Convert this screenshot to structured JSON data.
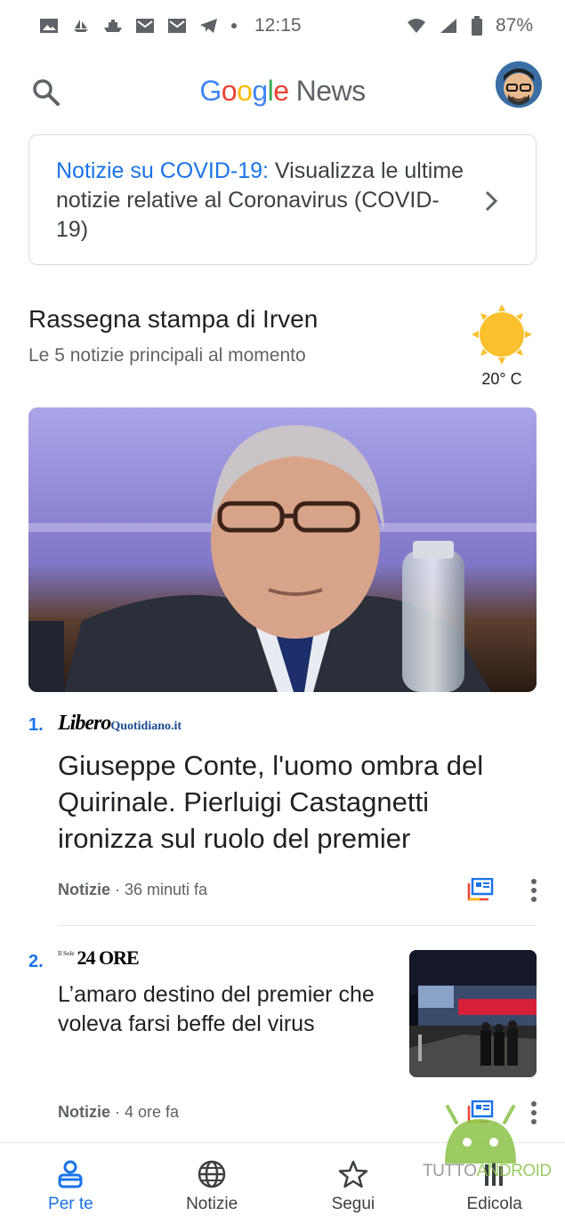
{
  "status_bar": {
    "time": "12:15",
    "battery": "87%",
    "icons": [
      "image-icon",
      "sailboat-icon",
      "ship-icon",
      "gmail-icon",
      "gmail-icon",
      "telegram-icon",
      "dot-icon"
    ],
    "right_icons": [
      "wifi-icon",
      "signal-icon",
      "battery-icon"
    ]
  },
  "header": {
    "logo_letters": [
      "G",
      "o",
      "o",
      "g",
      "l",
      "e"
    ],
    "logo_suffix": "News",
    "search_icon": "search-icon",
    "avatar": "user-avatar"
  },
  "covid_card": {
    "link_text": "Notizie su COVID-19:",
    "body_text": " Visualizza le ultime notizie relative al Coronavirus (COVID-19)",
    "chevron_icon": "chevron-right-icon"
  },
  "briefing": {
    "title": "Rassegna stampa di Irven",
    "subtitle": "Le 5 notizie principali al momento",
    "weather_icon": "sun-icon",
    "temperature": "20° C"
  },
  "stories": [
    {
      "number": "1.",
      "publisher_main": "Libero",
      "publisher_suffix": "Quotidiano.it",
      "title": "Giuseppe Conte, l'uomo ombra del Quirinale. Pierluigi Castagnetti ironizza sul ruolo del premier",
      "source": "Notizie",
      "time": " · 36 minuti fa"
    },
    {
      "number": "2.",
      "publisher_small": "Il Sole",
      "publisher_main": "24 ORE",
      "title": "L’amaro destino del premier che voleva farsi beffe del virus",
      "source": "Notizie",
      "time": " · 4 ore fa"
    }
  ],
  "bottom_nav": [
    {
      "label": "Per te",
      "icon": "for-you-icon",
      "active": true
    },
    {
      "label": "Notizie",
      "icon": "globe-icon",
      "active": false
    },
    {
      "label": "Segui",
      "icon": "star-icon",
      "active": false
    },
    {
      "label": "Edicola",
      "icon": "newsstand-icon",
      "active": false
    }
  ],
  "watermark": {
    "text_main": "TUTTO",
    "text_accent": "ANDROID"
  },
  "colors": {
    "accent": "#1a73e8",
    "google_blue": "#4285F4",
    "google_red": "#EA4335",
    "google_yellow": "#FBBC05",
    "google_green": "#34A853"
  }
}
